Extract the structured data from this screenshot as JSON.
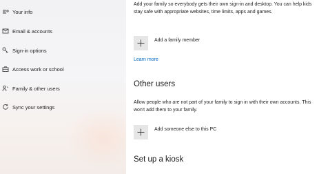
{
  "sidebar": {
    "items": [
      {
        "label": "Your info",
        "icon": "person-lines-icon"
      },
      {
        "label": "Email & accounts",
        "icon": "mail-icon"
      },
      {
        "label": "Sign-in options",
        "icon": "key-icon"
      },
      {
        "label": "Access work or school",
        "icon": "briefcase-icon"
      },
      {
        "label": "Family & other users",
        "icon": "people-icon"
      },
      {
        "label": "Sync your settings",
        "icon": "sync-icon"
      }
    ]
  },
  "main": {
    "family": {
      "description": "Add your family so everybody gets their own sign-in and desktop. You can help kids stay safe with appropriate websites, time limits, apps and games.",
      "add_label": "Add a family member",
      "learn_more": "Learn more"
    },
    "other_users": {
      "heading": "Other users",
      "description": "Allow people who are not part of your family to sign in with their own accounts. This won't add them to your family.",
      "add_label": "Add someone else to this PC"
    },
    "kiosk": {
      "heading": "Set up a kiosk"
    }
  },
  "colors": {
    "link": "#0067c0",
    "add_button_bg": "#e6e6e6"
  }
}
